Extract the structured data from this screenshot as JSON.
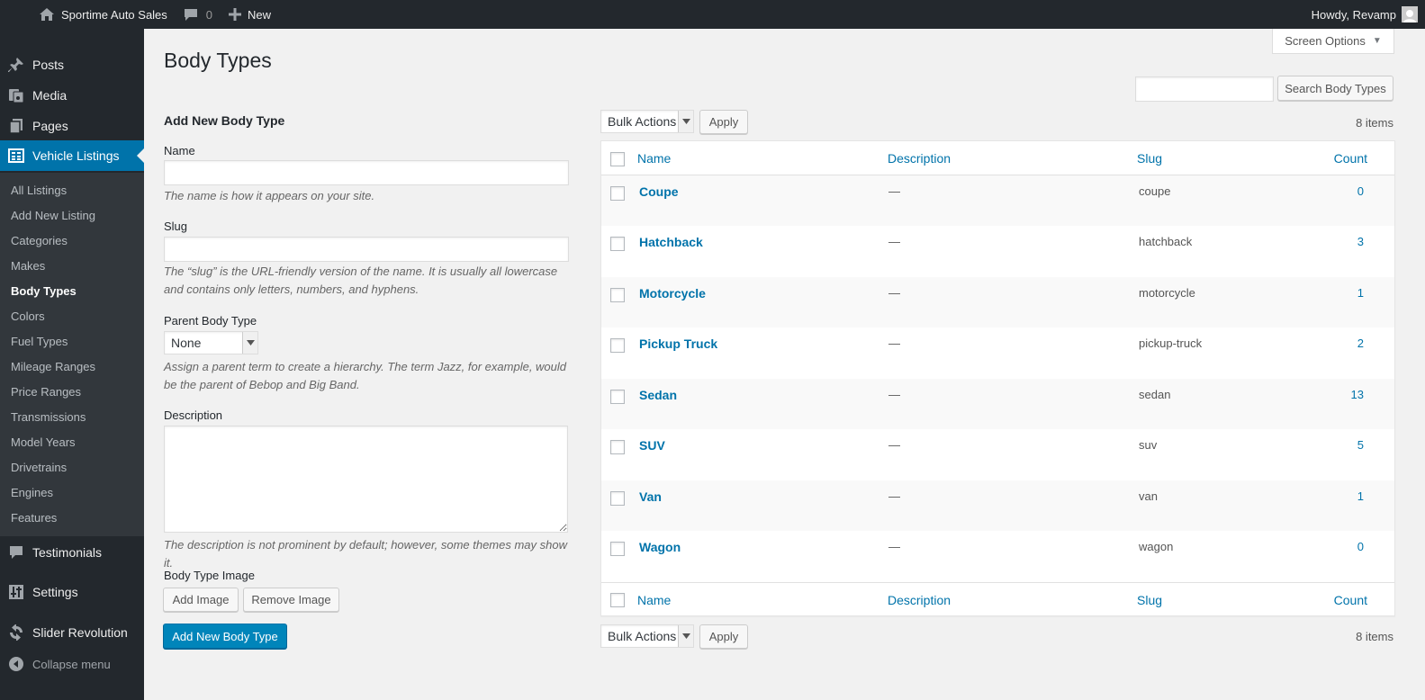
{
  "adminbar": {
    "site_name": "Sportime Auto Sales",
    "comments_count": "0",
    "new_label": "New",
    "howdy": "Howdy, Revamp"
  },
  "sidebar": {
    "top_items": [
      {
        "label": "Posts",
        "icon": "pushpin-icon"
      },
      {
        "label": "Media",
        "icon": "media-icon"
      },
      {
        "label": "Pages",
        "icon": "pages-icon"
      },
      {
        "label": "Vehicle Listings",
        "icon": "listings-icon"
      },
      {
        "label": "Testimonials",
        "icon": "speech-bubble-icon"
      },
      {
        "label": "Settings",
        "icon": "settings-sliders-icon"
      },
      {
        "label": "Slider Revolution",
        "icon": "refresh-icon"
      }
    ],
    "submenu": [
      "All Listings",
      "Add New Listing",
      "Categories",
      "Makes",
      "Body Types",
      "Colors",
      "Fuel Types",
      "Mileage Ranges",
      "Price Ranges",
      "Transmissions",
      "Model Years",
      "Drivetrains",
      "Engines",
      "Features"
    ],
    "collapse_label": "Collapse menu"
  },
  "header": {
    "screen_options": "Screen Options",
    "title": "Body Types"
  },
  "search": {
    "value": "",
    "button": "Search Body Types"
  },
  "form": {
    "heading": "Add New Body Type",
    "name_label": "Name",
    "name_hint": "The name is how it appears on your site.",
    "slug_label": "Slug",
    "slug_hint": "The “slug” is the URL-friendly version of the name. It is usually all lowercase and contains only letters, numbers, and hyphens.",
    "parent_label": "Parent Body Type",
    "parent_value": "None",
    "parent_hint": "Assign a parent term to create a hierarchy. The term Jazz, for example, would be the parent of Bebop and Big Band.",
    "description_label": "Description",
    "description_hint": "The description is not prominent by default; however, some themes may show it.",
    "image_label": "Body Type Image",
    "add_image": "Add Image",
    "remove_image": "Remove Image",
    "submit": "Add New Body Type"
  },
  "table": {
    "bulk_actions": "Bulk Actions",
    "apply": "Apply",
    "items_count": "8 items",
    "columns": [
      "Name",
      "Description",
      "Slug",
      "Count"
    ],
    "rows": [
      {
        "name": "Coupe",
        "description": "—",
        "slug": "coupe",
        "count": "0"
      },
      {
        "name": "Hatchback",
        "description": "—",
        "slug": "hatchback",
        "count": "3"
      },
      {
        "name": "Motorcycle",
        "description": "—",
        "slug": "motorcycle",
        "count": "1"
      },
      {
        "name": "Pickup Truck",
        "description": "—",
        "slug": "pickup-truck",
        "count": "2"
      },
      {
        "name": "Sedan",
        "description": "—",
        "slug": "sedan",
        "count": "13"
      },
      {
        "name": "SUV",
        "description": "—",
        "slug": "suv",
        "count": "5"
      },
      {
        "name": "Van",
        "description": "—",
        "slug": "van",
        "count": "1"
      },
      {
        "name": "Wagon",
        "description": "—",
        "slug": "wagon",
        "count": "0"
      }
    ]
  },
  "colors": {
    "adminbar_bg": "#23282d",
    "accent": "#0073aa",
    "primary_button": "#0085ba",
    "page_bg": "#f1f1f1"
  }
}
